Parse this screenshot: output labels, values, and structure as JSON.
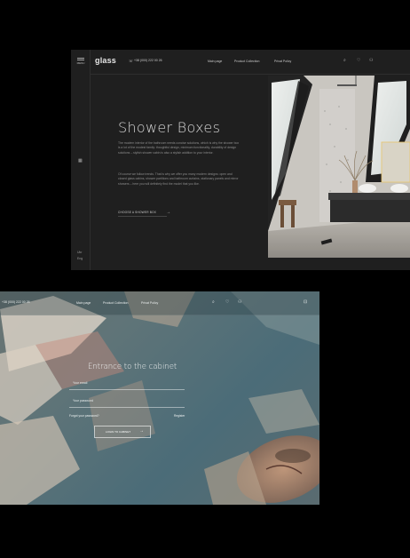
{
  "mock1": {
    "menu_label": "MENU",
    "logo": "glass",
    "phone": "+38 (000) 222 00 26",
    "nav": [
      "Main page",
      "Product Collection",
      "Privat Policy"
    ],
    "icons": {
      "phone": "phone-icon",
      "search": "search-icon",
      "favorite": "heart-icon",
      "account": "user-icon",
      "side": "grid-icon"
    },
    "title": "Shower Boxes",
    "text1": "The modern interior of the bathroom needs concise solutions, which is why the shower box is a lot of the modest family: thoughtful design, minimum functionality, durability of design solutions – stylish shower cabin is also a stylish addition to your interior.",
    "text2": "Of course we follow trends. That is why we offer you many modern designs: open and closed glass cabins, shower partitions and bathroom curtains, stationary panels and mirror showers – here you will definitely find the model that you like.",
    "cta": "CHOOSE A SHOWER BOX",
    "lang": [
      "Ukr",
      "Eng"
    ]
  },
  "mock2": {
    "phone": "+38 (000) 222 00 26",
    "nav": [
      "Main page",
      "Product Collection",
      "Privat Policy"
    ],
    "icons": {
      "search": "search-icon",
      "favorite": "heart-icon",
      "account": "user-icon",
      "cart": "bag-icon"
    },
    "title": "Entrance to the cabinet",
    "email_placeholder": "Your email",
    "password_placeholder": "Your password",
    "forgot": "Forgot your password?",
    "register": "Register",
    "login_button": "LOGIN TO CABINET"
  }
}
